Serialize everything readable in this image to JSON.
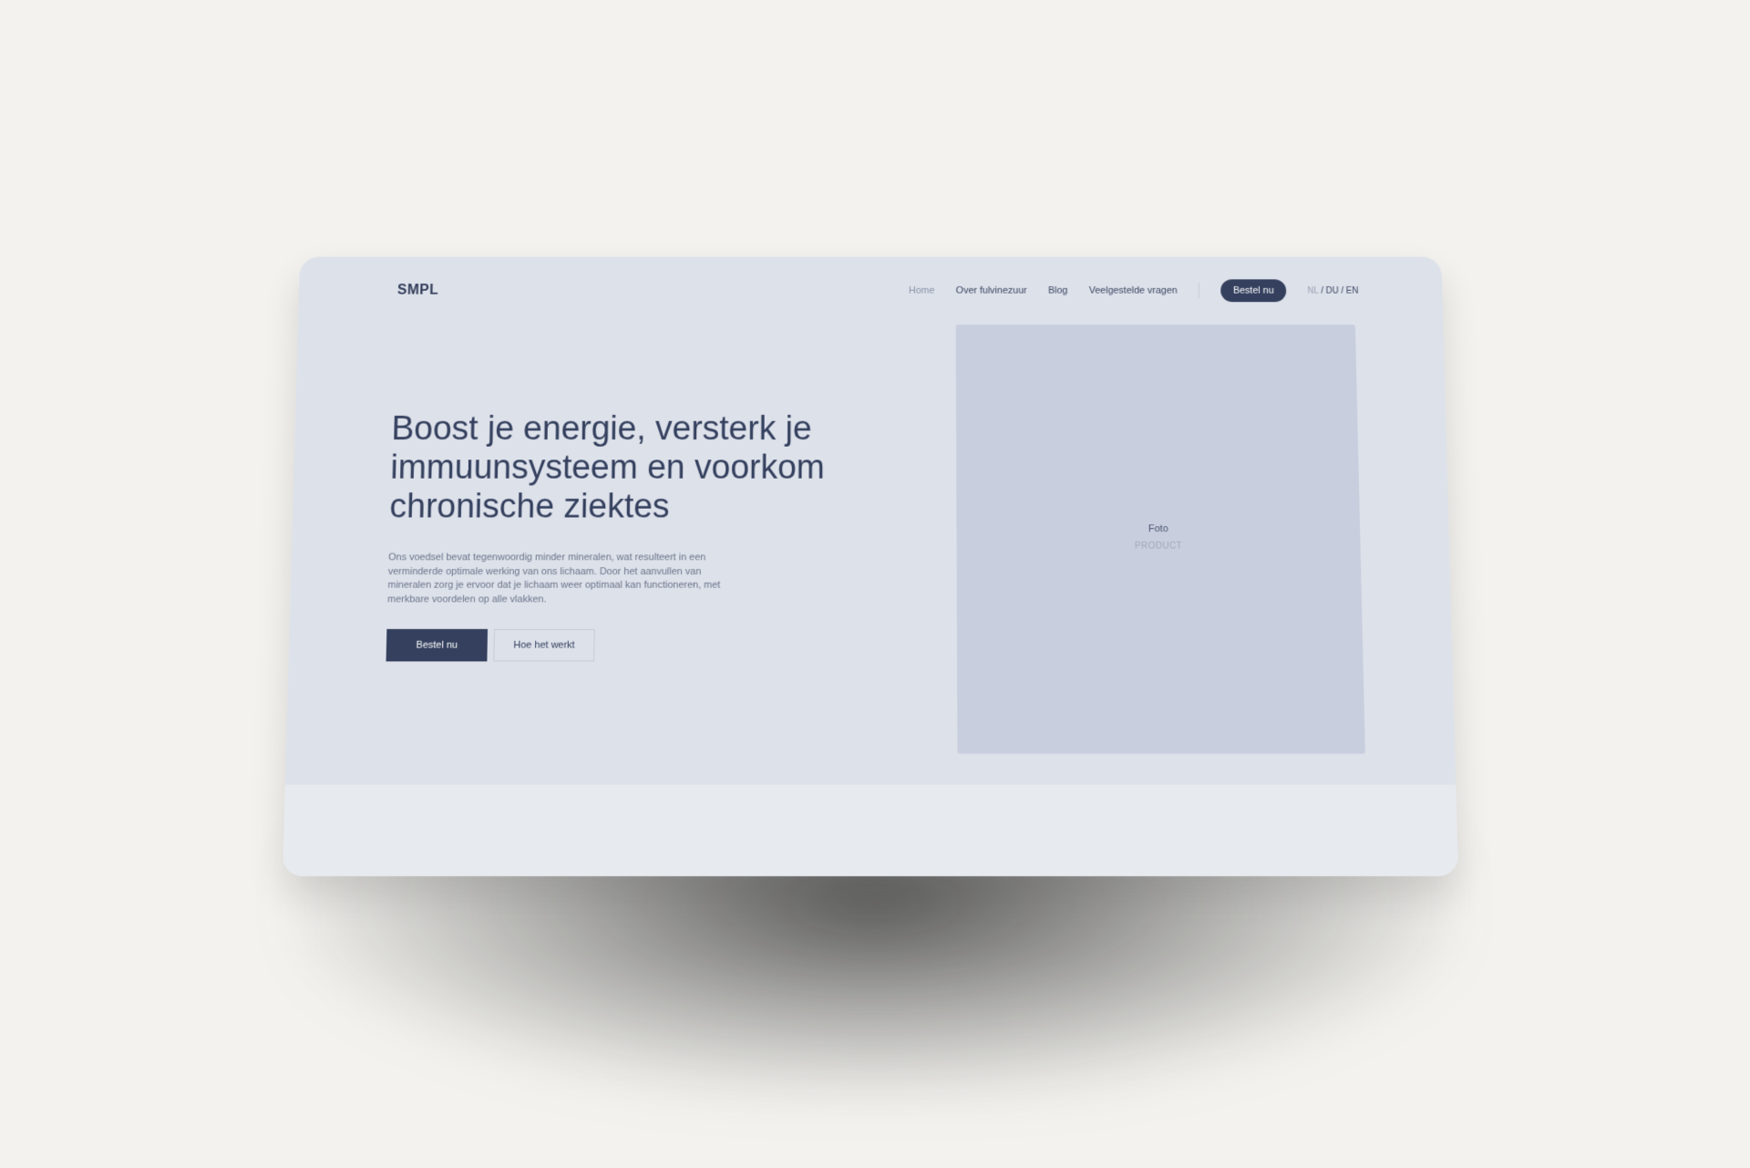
{
  "header": {
    "logo": "SMPL",
    "nav": [
      {
        "label": "Home"
      },
      {
        "label": "Over fulvinezuur"
      },
      {
        "label": "Blog"
      },
      {
        "label": "Veelgestelde vragen"
      }
    ],
    "cta": "Bestel nu",
    "lang": {
      "nl": "NL",
      "sep1": " / ",
      "du": "DU",
      "sep2": " / ",
      "en": "EN"
    }
  },
  "hero": {
    "headline": "Boost je energie, versterk je immuunsysteem en voorkom chronische ziektes",
    "body": "Ons voedsel bevat tegenwoordig minder mineralen, wat resulteert in een verminderde optimale werking van ons lichaam. Door het aanvullen van mineralen zorg je ervoor dat je lichaam weer optimaal kan functioneren, met merkbare voordelen op alle vlakken.",
    "primary_button": "Bestel nu",
    "secondary_button": "Hoe het werkt",
    "photo_label": "Foto",
    "photo_sub": "PRODUCT"
  },
  "colors": {
    "background": "#f3f2ee",
    "hero": "#dde1ea",
    "accent": "#34405e",
    "photo": "#c8cedd"
  }
}
